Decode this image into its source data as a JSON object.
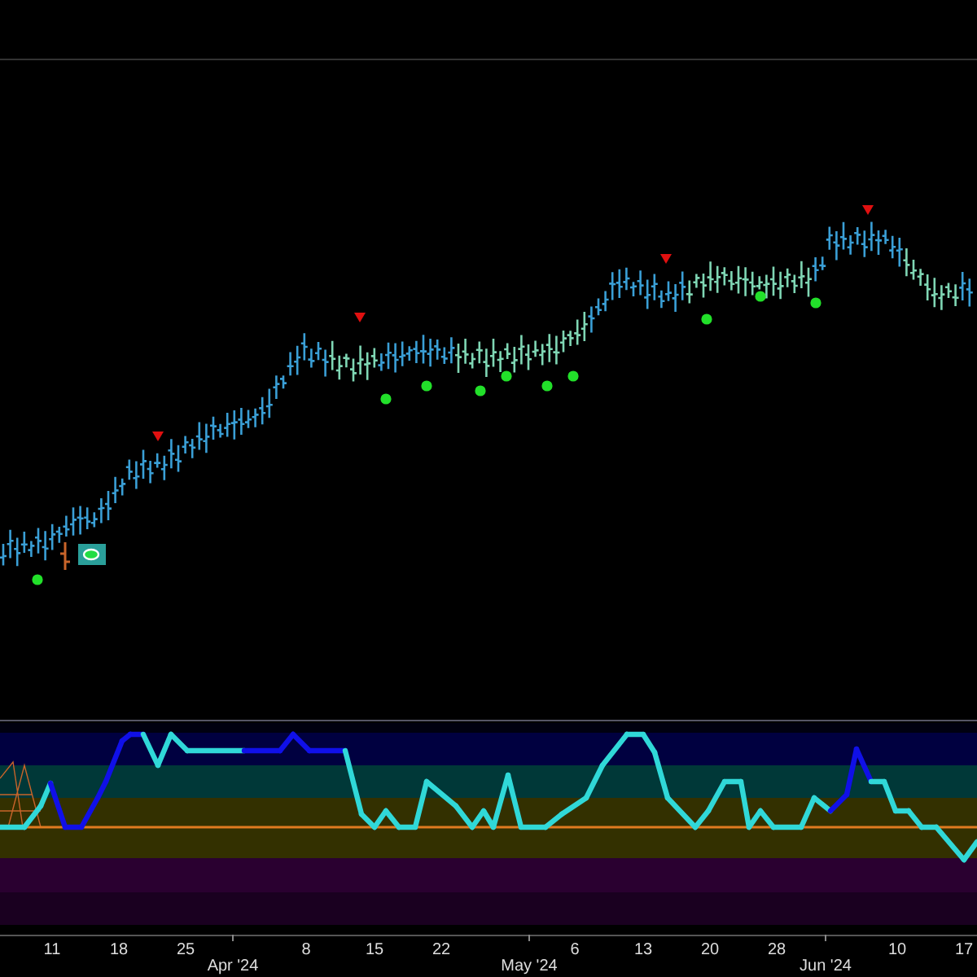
{
  "x_axis": {
    "day_labels": [
      "11",
      "18",
      "25",
      "8",
      "15",
      "22",
      "6",
      "13",
      "20",
      "28",
      "10",
      "17"
    ],
    "month_labels": [
      "Apr '24",
      "May '24",
      "Jun '24"
    ]
  }
}
